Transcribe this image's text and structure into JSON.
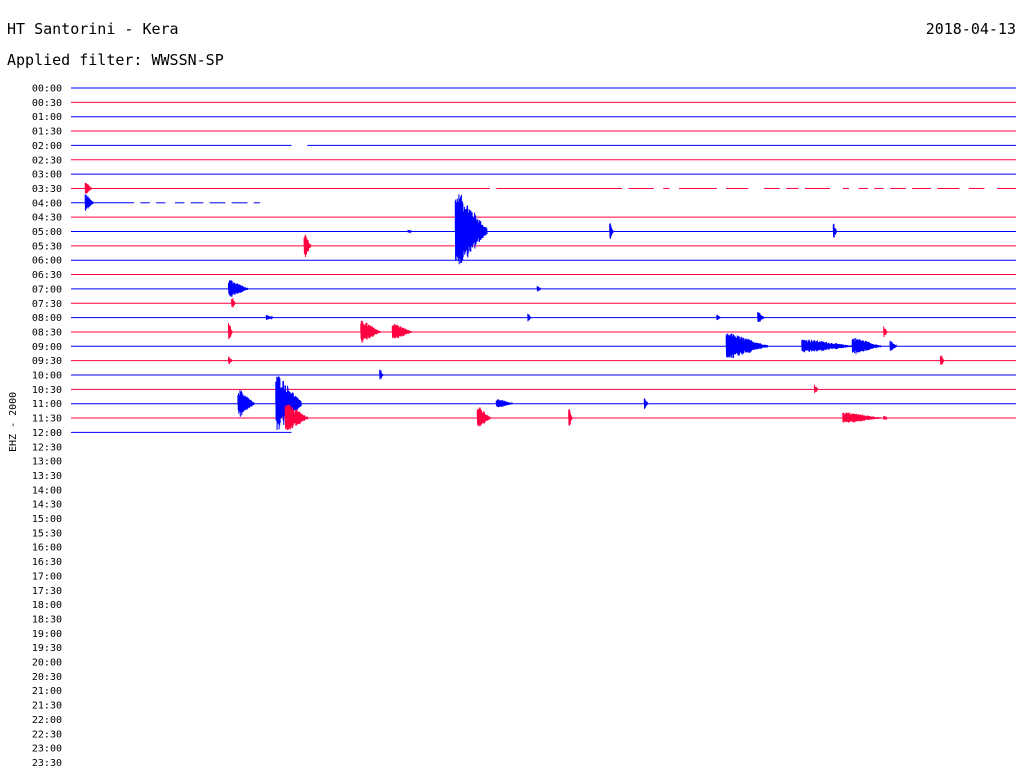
{
  "header": {
    "station": "HT Santorini - Kera",
    "filter": "Applied filter: WWSSN-SP",
    "date": "2018-04-13"
  },
  "channel_label": "EHZ - 2000",
  "colors": {
    "blue_trace": "#0000ff",
    "red_trace": "#ff0040",
    "background": "#ffffff",
    "label": "#000000"
  },
  "chart_data": {
    "type": "helicorder",
    "row_colors": [
      "blue",
      "red"
    ],
    "time_labels": [
      "00:00",
      "00:30",
      "01:00",
      "01:30",
      "02:00",
      "02:30",
      "03:00",
      "03:30",
      "04:00",
      "04:30",
      "05:00",
      "05:30",
      "06:00",
      "06:30",
      "07:00",
      "07:30",
      "08:00",
      "08:30",
      "09:00",
      "09:30",
      "10:00",
      "10:30",
      "11:00",
      "11:30",
      "12:00",
      "12:30",
      "13:00",
      "13:30",
      "14:00",
      "14:30",
      "15:00",
      "15:30",
      "16:00",
      "16:30",
      "17:00",
      "17:30",
      "18:00",
      "18:30",
      "19:00",
      "19:30",
      "20:00",
      "20:30",
      "21:00",
      "21:30",
      "22:00",
      "22:30",
      "23:00",
      "23:30"
    ],
    "x_range_minutes": [
      0,
      30
    ],
    "data_until": "12:07",
    "rows": [
      {
        "row": "00:00",
        "gaps": [],
        "events": []
      },
      {
        "row": "00:30",
        "gaps": [],
        "events": []
      },
      {
        "row": "01:00",
        "gaps": [],
        "events": []
      },
      {
        "row": "01:30",
        "gaps": [],
        "events": []
      },
      {
        "row": "02:00",
        "gaps": [
          [
            7.0,
            7.5
          ]
        ],
        "events": []
      },
      {
        "row": "02:30",
        "gaps": [],
        "events": []
      },
      {
        "row": "03:00",
        "gaps": [],
        "events": []
      },
      {
        "row": "03:30",
        "gaps": [
          [
            13.3,
            13.5
          ],
          [
            17.5,
            17.7
          ],
          [
            18.5,
            18.8
          ],
          [
            19.0,
            19.3
          ],
          [
            20.5,
            20.8
          ],
          [
            21.5,
            22.0
          ],
          [
            22.5,
            22.7
          ],
          [
            23.1,
            23.3
          ],
          [
            24.1,
            24.5
          ],
          [
            24.7,
            25.0
          ],
          [
            25.3,
            25.5
          ],
          [
            25.8,
            26.0
          ],
          [
            26.5,
            26.7
          ],
          [
            27.3,
            27.5
          ],
          [
            28.2,
            28.5
          ],
          [
            29.0,
            29.4
          ]
        ],
        "events": [
          {
            "minute": 0.45,
            "amplitude": 0.45,
            "width_min": 0.2
          }
        ]
      },
      {
        "row": "04:00",
        "gaps": [
          [
            2.0,
            2.2
          ],
          [
            2.5,
            2.7
          ],
          [
            3.0,
            3.3
          ],
          [
            3.6,
            3.8
          ],
          [
            4.2,
            4.4
          ],
          [
            4.9,
            5.1
          ],
          [
            5.6,
            5.8
          ],
          [
            6.0,
            30.0
          ]
        ],
        "events": [
          {
            "minute": 0.45,
            "amplitude": 0.6,
            "width_min": 0.25
          }
        ]
      },
      {
        "row": "04:30",
        "gaps": [],
        "events": []
      },
      {
        "row": "05:00",
        "gaps": [],
        "events": [
          {
            "minute": 10.7,
            "amplitude": 0.15,
            "width_min": 0.1
          },
          {
            "minute": 12.2,
            "amplitude": 2.7,
            "width_min": 1.0
          },
          {
            "minute": 17.1,
            "amplitude": 0.7,
            "width_min": 0.1
          },
          {
            "minute": 24.2,
            "amplitude": 0.6,
            "width_min": 0.1
          }
        ]
      },
      {
        "row": "05:30",
        "gaps": [],
        "events": [
          {
            "minute": 7.4,
            "amplitude": 0.9,
            "width_min": 0.2
          }
        ]
      },
      {
        "row": "06:00",
        "gaps": [],
        "events": []
      },
      {
        "row": "06:30",
        "gaps": [],
        "events": []
      },
      {
        "row": "07:00",
        "gaps": [],
        "events": [
          {
            "minute": 5.0,
            "amplitude": 0.65,
            "width_min": 0.6
          },
          {
            "minute": 14.8,
            "amplitude": 0.2,
            "width_min": 0.1
          }
        ]
      },
      {
        "row": "07:30",
        "gaps": [],
        "events": [
          {
            "minute": 5.1,
            "amplitude": 0.5,
            "width_min": 0.1
          }
        ]
      },
      {
        "row": "08:00",
        "gaps": [],
        "events": [
          {
            "minute": 6.2,
            "amplitude": 0.2,
            "width_min": 0.2
          },
          {
            "minute": 14.5,
            "amplitude": 0.35,
            "width_min": 0.1
          },
          {
            "minute": 20.5,
            "amplitude": 0.3,
            "width_min": 0.1
          },
          {
            "minute": 21.8,
            "amplitude": 0.4,
            "width_min": 0.2
          }
        ]
      },
      {
        "row": "08:30",
        "gaps": [],
        "events": [
          {
            "minute": 5.0,
            "amplitude": 0.85,
            "width_min": 0.1
          },
          {
            "minute": 9.2,
            "amplitude": 0.8,
            "width_min": 0.6
          },
          {
            "minute": 10.2,
            "amplitude": 0.6,
            "width_min": 0.6
          },
          {
            "minute": 25.8,
            "amplitude": 0.4,
            "width_min": 0.1
          }
        ]
      },
      {
        "row": "09:00",
        "gaps": [],
        "events": [
          {
            "minute": 20.8,
            "amplitude": 0.9,
            "width_min": 1.3
          },
          {
            "minute": 23.2,
            "amplitude": 0.5,
            "width_min": 1.6
          },
          {
            "minute": 24.8,
            "amplitude": 0.6,
            "width_min": 0.9
          },
          {
            "minute": 26.0,
            "amplitude": 0.4,
            "width_min": 0.2
          }
        ]
      },
      {
        "row": "09:30",
        "gaps": [],
        "events": [
          {
            "minute": 5.0,
            "amplitude": 0.3,
            "width_min": 0.1
          },
          {
            "minute": 27.6,
            "amplitude": 0.5,
            "width_min": 0.1
          }
        ]
      },
      {
        "row": "10:00",
        "gaps": [],
        "events": [
          {
            "minute": 9.8,
            "amplitude": 0.45,
            "width_min": 0.1
          }
        ]
      },
      {
        "row": "10:30",
        "gaps": [],
        "events": [
          {
            "minute": 23.6,
            "amplitude": 0.35,
            "width_min": 0.1
          }
        ]
      },
      {
        "row": "11:00",
        "gaps": [],
        "events": [
          {
            "minute": 5.3,
            "amplitude": 1.0,
            "width_min": 0.5
          },
          {
            "minute": 6.5,
            "amplitude": 2.0,
            "width_min": 0.8
          },
          {
            "minute": 13.5,
            "amplitude": 0.35,
            "width_min": 0.5
          },
          {
            "minute": 18.2,
            "amplitude": 0.4,
            "width_min": 0.1
          }
        ]
      },
      {
        "row": "11:30",
        "gaps": [],
        "events": [
          {
            "minute": 6.8,
            "amplitude": 1.0,
            "width_min": 0.7
          },
          {
            "minute": 12.9,
            "amplitude": 0.8,
            "width_min": 0.4
          },
          {
            "minute": 15.8,
            "amplitude": 0.9,
            "width_min": 0.1
          },
          {
            "minute": 24.5,
            "amplitude": 0.4,
            "width_min": 1.2
          },
          {
            "minute": 25.8,
            "amplitude": 0.2,
            "width_min": 0.1
          }
        ]
      },
      {
        "row": "12:00",
        "gaps": [],
        "events": []
      },
      {
        "row": "12:30",
        "gaps": [],
        "events": []
      },
      {
        "row": "13:00",
        "gaps": [],
        "events": []
      },
      {
        "row": "13:30",
        "gaps": [],
        "events": []
      },
      {
        "row": "14:00",
        "gaps": [],
        "events": []
      },
      {
        "row": "14:30",
        "gaps": [],
        "events": []
      },
      {
        "row": "15:00",
        "gaps": [],
        "events": []
      },
      {
        "row": "15:30",
        "gaps": [],
        "events": []
      },
      {
        "row": "16:00",
        "gaps": [],
        "events": []
      },
      {
        "row": "16:30",
        "gaps": [],
        "events": []
      },
      {
        "row": "17:00",
        "gaps": [],
        "events": []
      },
      {
        "row": "17:30",
        "gaps": [],
        "events": []
      },
      {
        "row": "18:00",
        "gaps": [],
        "events": []
      },
      {
        "row": "18:30",
        "gaps": [],
        "events": []
      },
      {
        "row": "19:00",
        "gaps": [],
        "events": []
      },
      {
        "row": "19:30",
        "gaps": [],
        "events": []
      },
      {
        "row": "20:00",
        "gaps": [],
        "events": []
      },
      {
        "row": "20:30",
        "gaps": [],
        "events": []
      },
      {
        "row": "21:00",
        "gaps": [],
        "events": []
      },
      {
        "row": "21:30",
        "gaps": [],
        "events": []
      },
      {
        "row": "22:00",
        "gaps": [],
        "events": []
      },
      {
        "row": "22:30",
        "gaps": [],
        "events": []
      },
      {
        "row": "23:00",
        "gaps": [],
        "events": []
      },
      {
        "row": "23:30",
        "gaps": [],
        "events": []
      }
    ]
  }
}
